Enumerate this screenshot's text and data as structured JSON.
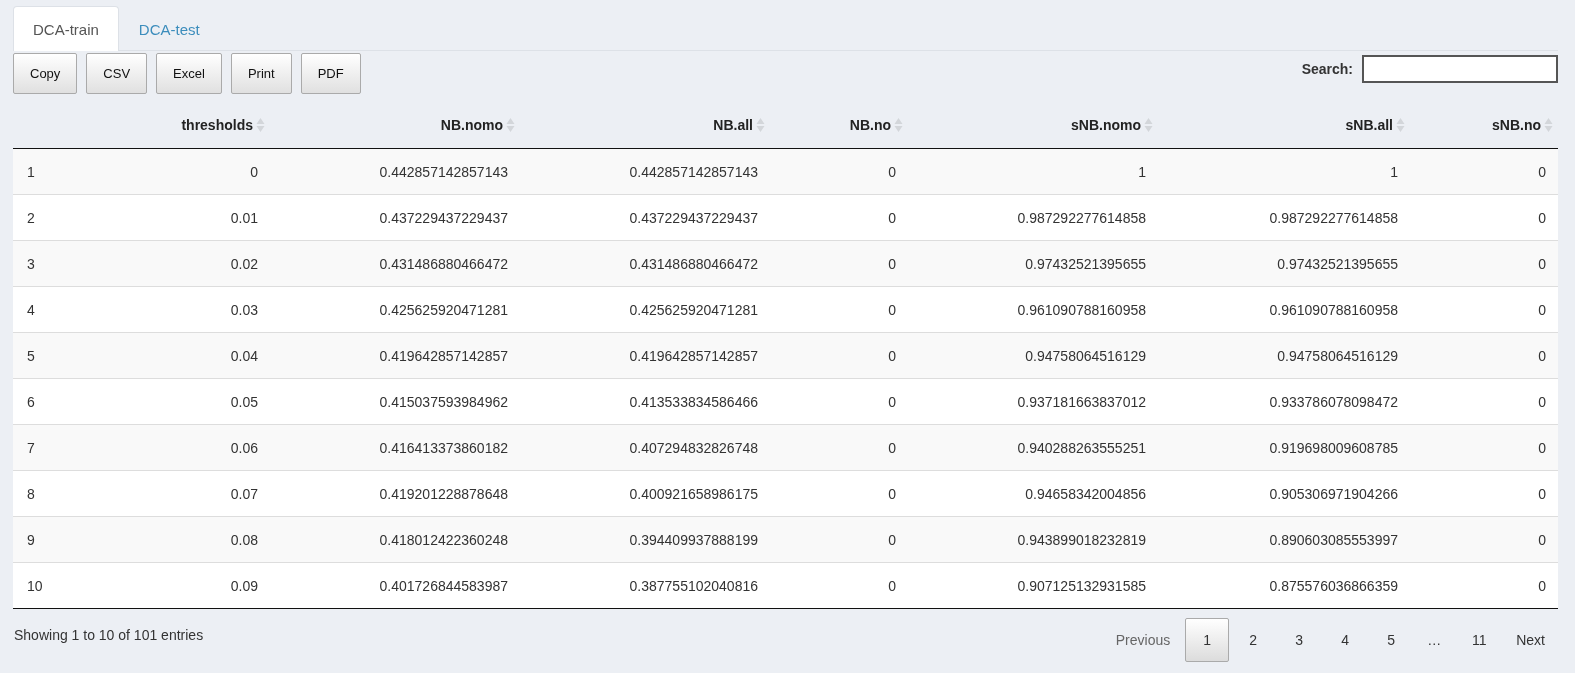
{
  "tabs": [
    {
      "label": "DCA-train",
      "selected": true
    },
    {
      "label": "DCA-test",
      "selected": false
    }
  ],
  "buttons": [
    "Copy",
    "CSV",
    "Excel",
    "Print",
    "PDF"
  ],
  "search": {
    "label": "Search:"
  },
  "table": {
    "columns": [
      "",
      "thresholds",
      "NB.nomo",
      "NB.all",
      "NB.no",
      "sNB.nomo",
      "sNB.all",
      "sNB.no"
    ],
    "rows": [
      [
        "1",
        "0",
        "0.442857142857143",
        "0.442857142857143",
        "0",
        "1",
        "1",
        "0"
      ],
      [
        "2",
        "0.01",
        "0.437229437229437",
        "0.437229437229437",
        "0",
        "0.987292277614858",
        "0.987292277614858",
        "0"
      ],
      [
        "3",
        "0.02",
        "0.431486880466472",
        "0.431486880466472",
        "0",
        "0.97432521395655",
        "0.97432521395655",
        "0"
      ],
      [
        "4",
        "0.03",
        "0.425625920471281",
        "0.425625920471281",
        "0",
        "0.961090788160958",
        "0.961090788160958",
        "0"
      ],
      [
        "5",
        "0.04",
        "0.419642857142857",
        "0.419642857142857",
        "0",
        "0.94758064516129",
        "0.94758064516129",
        "0"
      ],
      [
        "6",
        "0.05",
        "0.415037593984962",
        "0.413533834586466",
        "0",
        "0.937181663837012",
        "0.933786078098472",
        "0"
      ],
      [
        "7",
        "0.06",
        "0.416413373860182",
        "0.407294832826748",
        "0",
        "0.940288263555251",
        "0.919698009608785",
        "0"
      ],
      [
        "8",
        "0.07",
        "0.419201228878648",
        "0.400921658986175",
        "0",
        "0.94658342004856",
        "0.905306971904266",
        "0"
      ],
      [
        "9",
        "0.08",
        "0.418012422360248",
        "0.394409937888199",
        "0",
        "0.943899018232819",
        "0.890603085553997",
        "0"
      ],
      [
        "10",
        "0.09",
        "0.401726844583987",
        "0.387755102040816",
        "0",
        "0.907125132931585",
        "0.875576036866359",
        "0"
      ]
    ]
  },
  "info": "Showing 1 to 10 of 101 entries",
  "pagination": {
    "previous": {
      "label": "Previous",
      "disabled": true
    },
    "pages": [
      {
        "kind": "page",
        "label": "1",
        "selected": true
      },
      {
        "kind": "page",
        "label": "2",
        "selected": false
      },
      {
        "kind": "page",
        "label": "3",
        "selected": false
      },
      {
        "kind": "page",
        "label": "4",
        "selected": false
      },
      {
        "kind": "page",
        "label": "5",
        "selected": false
      },
      {
        "kind": "ellipsis",
        "label": "…",
        "selected": false
      },
      {
        "kind": "page",
        "label": "11",
        "selected": false
      }
    ],
    "next": {
      "label": "Next",
      "disabled": false
    }
  }
}
